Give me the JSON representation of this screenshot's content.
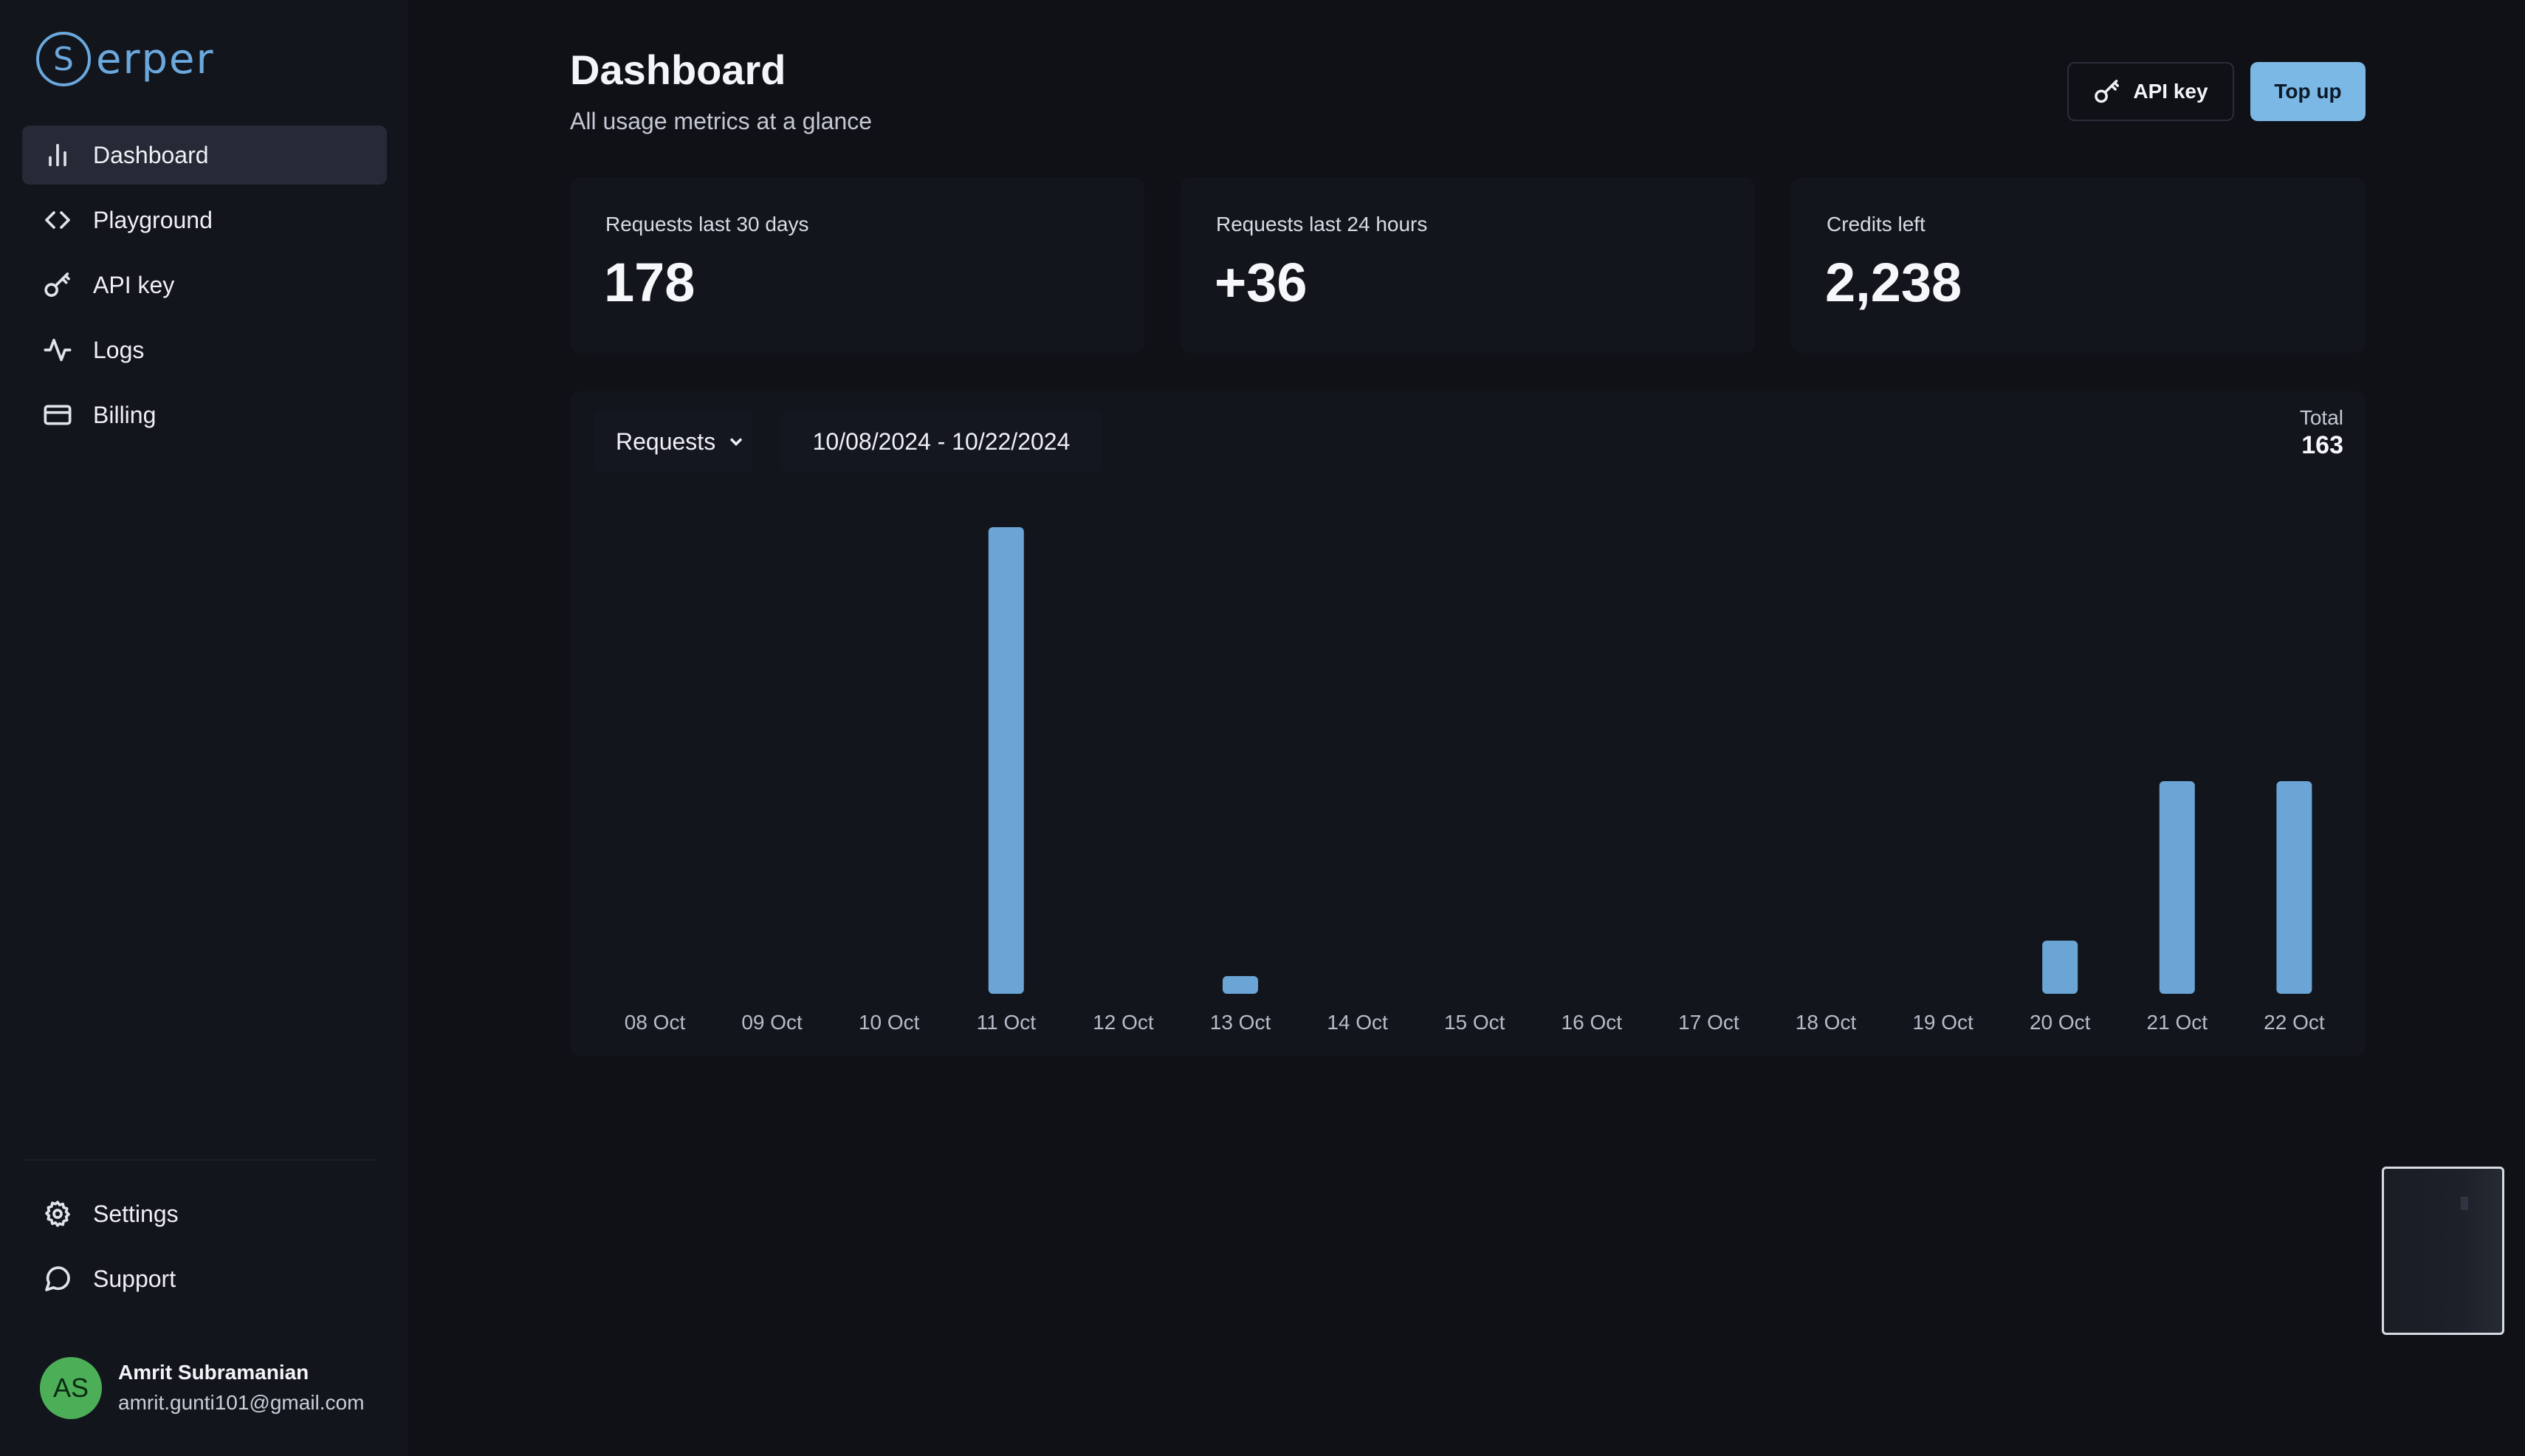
{
  "brand": {
    "logo_letter": "S",
    "logo_text": "erper",
    "accent": "#6aa8dd"
  },
  "sidebar": {
    "items": [
      {
        "label": "Dashboard",
        "icon": "bar-chart-icon",
        "active": true
      },
      {
        "label": "Playground",
        "icon": "code-icon",
        "active": false
      },
      {
        "label": "API key",
        "icon": "key-icon",
        "active": false
      },
      {
        "label": "Logs",
        "icon": "activity-icon",
        "active": false
      },
      {
        "label": "Billing",
        "icon": "credit-card-icon",
        "active": false
      }
    ],
    "bottom_items": [
      {
        "label": "Settings",
        "icon": "gear-icon"
      },
      {
        "label": "Support",
        "icon": "chat-icon"
      }
    ],
    "user": {
      "initials": "AS",
      "name": "Amrit Subramanian",
      "email": "amrit.gunti101@gmail.com",
      "avatar_color": "#4caf58"
    }
  },
  "header": {
    "title": "Dashboard",
    "subtitle": "All usage metrics at a glance",
    "api_key_label": "API key",
    "top_up_label": "Top up",
    "top_up_color": "#7bb8e6"
  },
  "stats": [
    {
      "label": "Requests last 30 days",
      "value": "178"
    },
    {
      "label": "Requests last 24 hours",
      "value": "+36"
    },
    {
      "label": "Credits left",
      "value": "2,238"
    }
  ],
  "chart_panel": {
    "metric_label": "Requests",
    "date_range": "10/08/2024 - 10/22/2024",
    "total_label": "Total",
    "total_value": "163"
  },
  "chart_data": {
    "type": "bar",
    "title": "",
    "xlabel": "",
    "ylabel": "",
    "categories": [
      "08 Oct",
      "09 Oct",
      "10 Oct",
      "11 Oct",
      "12 Oct",
      "13 Oct",
      "14 Oct",
      "15 Oct",
      "16 Oct",
      "17 Oct",
      "18 Oct",
      "19 Oct",
      "20 Oct",
      "21 Oct",
      "22 Oct"
    ],
    "values": [
      0,
      0,
      0,
      79,
      0,
      3,
      0,
      0,
      0,
      0,
      0,
      0,
      9,
      36,
      36
    ],
    "ylim": [
      0,
      79
    ],
    "grid": false,
    "bar_color": "#6aa5d6"
  }
}
